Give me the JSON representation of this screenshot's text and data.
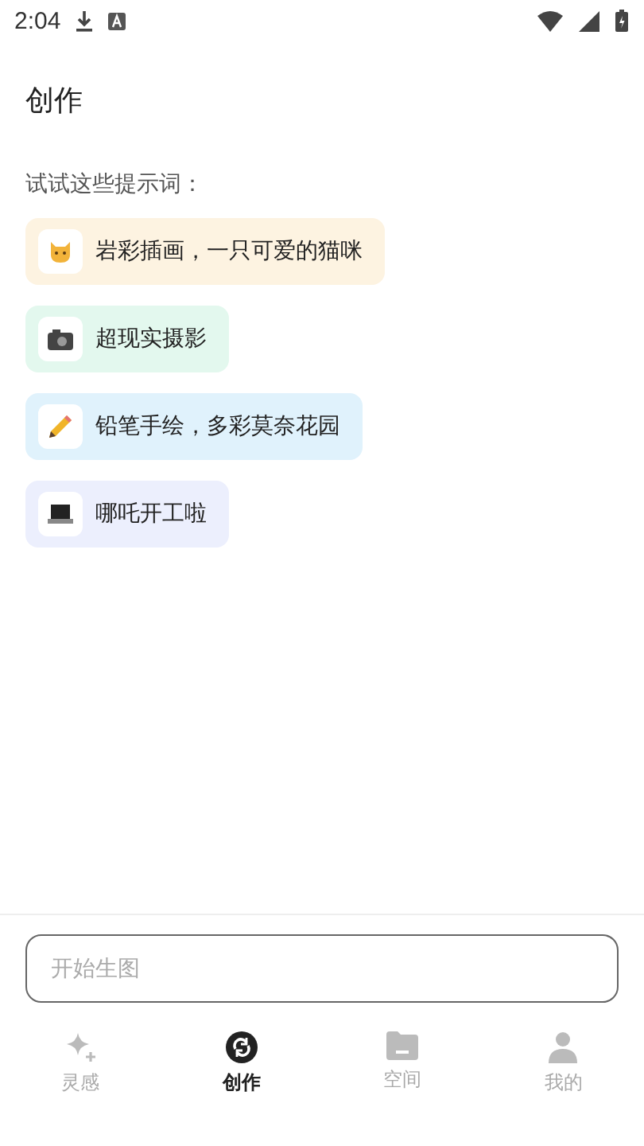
{
  "status_bar": {
    "time": "2:04"
  },
  "title": "创作",
  "hint": "试试这些提示词：",
  "prompts": [
    {
      "kind": "cat",
      "label": "岩彩插画，一只可爱的猫咪",
      "color": "#fdf3e1"
    },
    {
      "kind": "camera",
      "label": "超现实摄影",
      "color": "#e3f8ee"
    },
    {
      "kind": "pencil",
      "label": "铅笔手绘，多彩莫奈花园",
      "color": "#e0f2fc"
    },
    {
      "kind": "laptop",
      "label": "哪吒开工啦",
      "color": "#eceffd"
    }
  ],
  "input": {
    "placeholder": "开始生图"
  },
  "nav": [
    {
      "kind": "sparkle",
      "label": "灵感",
      "selected": false
    },
    {
      "kind": "create",
      "label": "创作",
      "selected": true
    },
    {
      "kind": "folder",
      "label": "空间",
      "selected": false
    },
    {
      "kind": "person",
      "label": "我的",
      "selected": false
    }
  ]
}
